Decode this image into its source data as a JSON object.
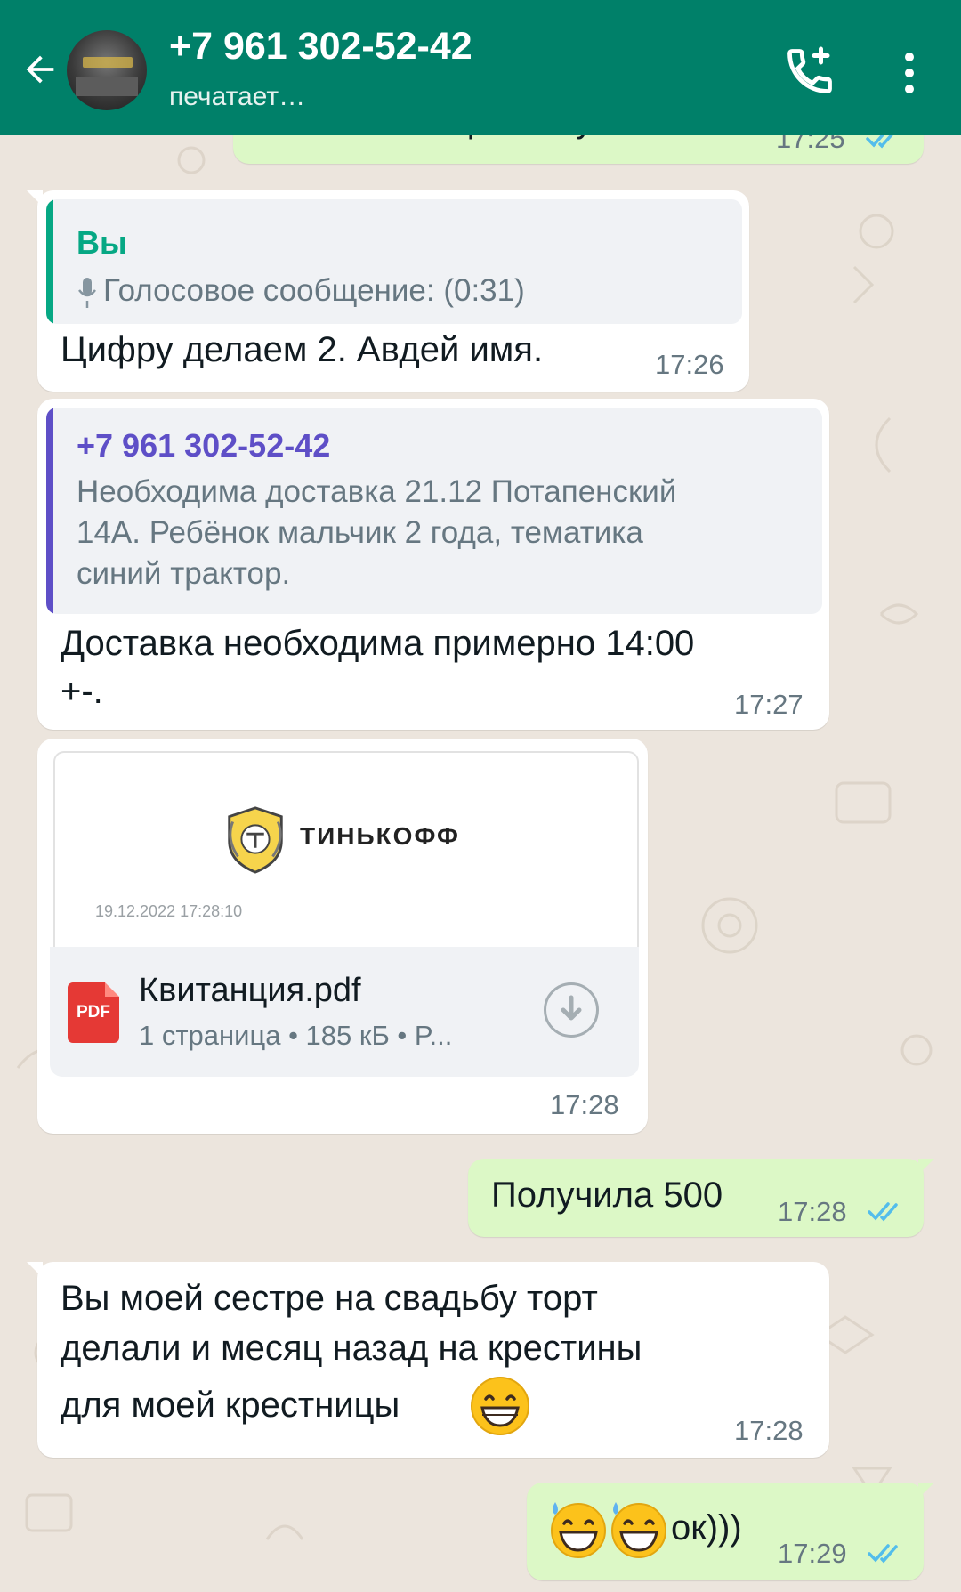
{
  "header": {
    "contact_name": "+7 961 302-52-42",
    "status": "печатает…",
    "back_icon": "arrow-back-icon",
    "call_icon": "add-call-icon",
    "menu_icon": "more-vert-icon",
    "color": "#008069"
  },
  "messages": [
    {
      "direction": "out",
      "text": "Остальное при получении",
      "time": "17:25",
      "read": true
    },
    {
      "direction": "in",
      "reply_to": {
        "author": "Вы",
        "text": "Голосовое сообщение: (0:31)",
        "icon": "mic-icon"
      },
      "text": "Цифру делаем 2. Авдей  имя.",
      "time": "17:26"
    },
    {
      "direction": "in",
      "reply_to": {
        "author": "+7 961 302-52-42",
        "lines": [
          "Необходима доставка 21.12 Потапенский",
          "14А. Ребёнок мальчик 2 года, тематика",
          "синий трактор."
        ]
      },
      "lines": [
        "Доставка необходима примерно 14:00",
        "+-."
      ],
      "time": "17:27"
    },
    {
      "direction": "in",
      "document": {
        "preview_brand": "ТИНЬКОФФ",
        "preview_date": "19.12.2022  17:28:10",
        "file_name": "Квитанция.pdf",
        "file_type": "PDF",
        "meta": "1 страница • 185 кБ • P..."
      },
      "time": "17:28"
    },
    {
      "direction": "out",
      "text": "Получила 500",
      "time": "17:28",
      "read": true
    },
    {
      "direction": "in",
      "lines": [
        "Вы моей сестре на свадьбу торт",
        "делали и месяц назад на крестины",
        "для моей крестницы"
      ],
      "emoji": "grinning-face",
      "time": "17:28"
    },
    {
      "direction": "out",
      "emoji": "grinning-sweat",
      "text": "ок)))",
      "time": "17:29",
      "read": true
    }
  ],
  "colors": {
    "incoming_bubble": "#ffffff",
    "outgoing_bubble": "#dcf8c6",
    "read_ticks": "#53bdeb",
    "quote_self": "#06a884",
    "quote_contact": "#5e4fc7",
    "wallpaper": "#ece5dd"
  }
}
